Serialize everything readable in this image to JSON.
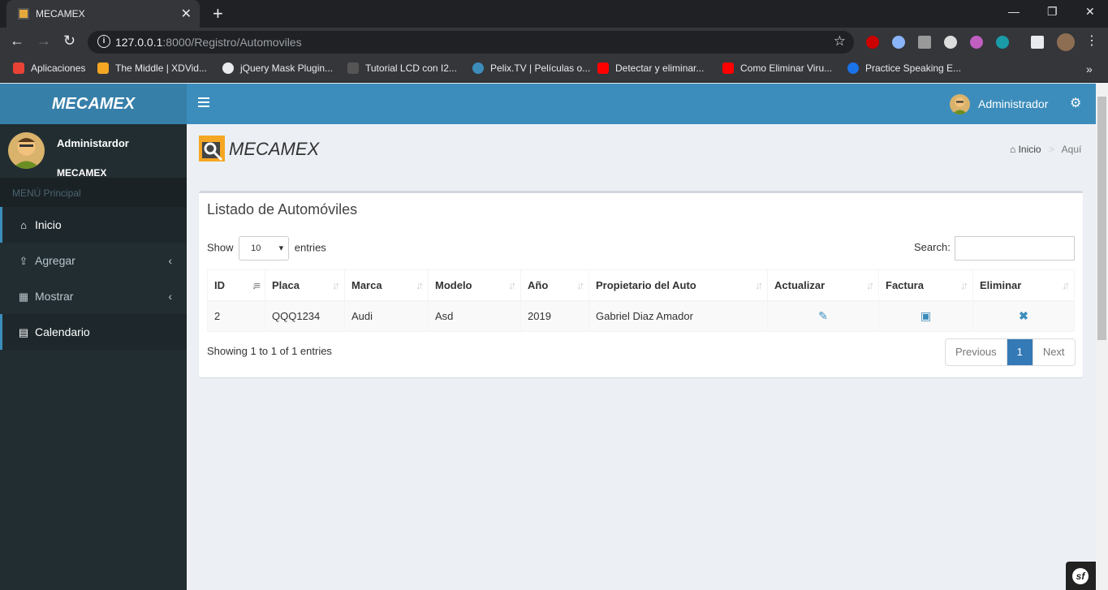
{
  "browser": {
    "tab_title": "MECAMEX",
    "url_host": "127.0.0.1",
    "url_rest": ":8000/Registro/Automoviles",
    "bookmarks": [
      "Aplicaciones",
      "The Middle | XDVid...",
      "jQuery Mask Plugin...",
      "Tutorial LCD con I2...",
      "Pelix.TV | Películas o...",
      "Detectar y eliminar...",
      "Como Eliminar Viru...",
      "Practice Speaking E..."
    ]
  },
  "header": {
    "logo": "MECAMEX",
    "user": "Administrador"
  },
  "sidebar": {
    "user_name": "Administardor",
    "user_org": "MECAMEX",
    "section": "MENÚ Principal",
    "items": [
      {
        "label": "Inicio",
        "icon": "home-icon"
      },
      {
        "label": "Agregar",
        "icon": "upload-icon"
      },
      {
        "label": "Mostrar",
        "icon": "table-icon"
      },
      {
        "label": "Calendario",
        "icon": "calendar-icon"
      }
    ]
  },
  "content": {
    "brand": "MECAMEX",
    "breadcrumb": {
      "home": "Inicio",
      "current": "Aquí"
    }
  },
  "box": {
    "title": "Listado de Automóviles",
    "show": "Show",
    "length_value": "10",
    "entries": "entries",
    "search_label": "Search:",
    "columns": [
      "ID",
      "Placa",
      "Marca",
      "Modelo",
      "Año",
      "Propietario del Auto",
      "Actualizar",
      "Factura",
      "Eliminar"
    ],
    "rows": [
      {
        "id": "2",
        "placa": "QQQ1234",
        "marca": "Audi",
        "modelo": "Asd",
        "anio": "2019",
        "propietario": "Gabriel Diaz Amador"
      }
    ],
    "info": "Showing 1 to 1 of 1 entries",
    "pager": {
      "previous": "Previous",
      "page": "1",
      "next": "Next"
    }
  }
}
